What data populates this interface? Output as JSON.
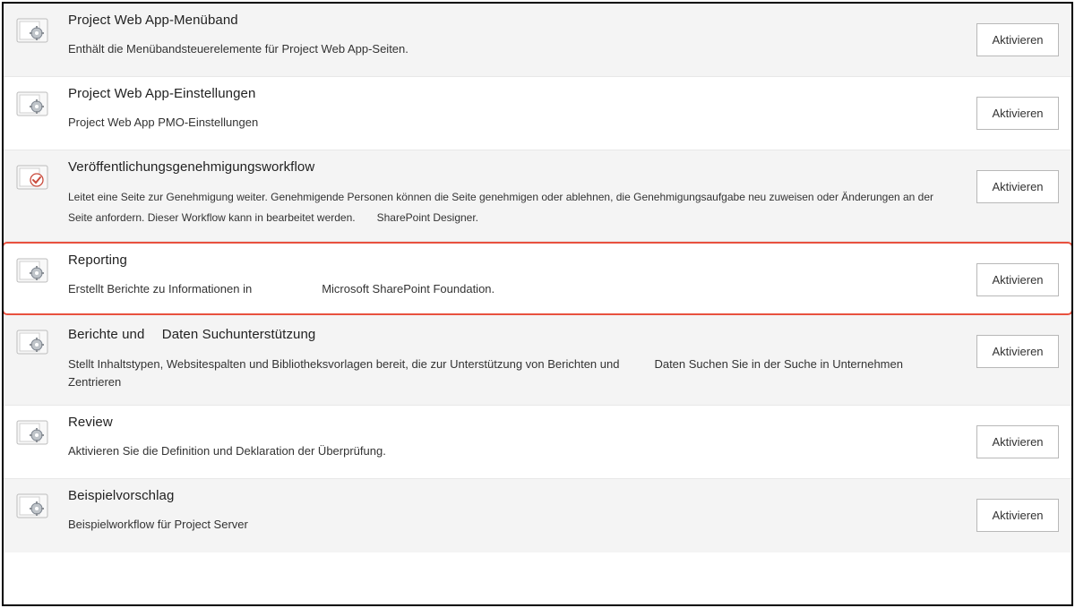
{
  "activateLabel": "Aktivieren",
  "features": [
    {
      "icon": "gear",
      "title": "Project Web App-Menüband",
      "desc": "Enthält die Menübandsteuerelemente für Project Web App-Seiten."
    },
    {
      "icon": "gear",
      "title": "Project Web App-Einstellungen",
      "desc": "Project Web App PMO-Einstellungen"
    },
    {
      "icon": "check",
      "title": "Veröffentlichungsgenehmigungsworkflow",
      "desc": "Leitet eine Seite zur Genehmigung weiter. Genehmigende Personen können die Seite genehmigen oder ablehnen, die Genehmigungsaufgabe neu zuweisen oder Änderungen an der Seite anfordern. Dieser Workflow kann in bearbeitet werden.　　SharePoint Designer."
    },
    {
      "icon": "gear",
      "title": "Reporting",
      "desc": "Erstellt Berichte zu Informationen in　　　　　　Microsoft SharePoint Foundation."
    },
    {
      "icon": "gear",
      "title": "Berichte und　 Daten  Suchunterstützung",
      "desc": "Stellt Inhaltstypen, Websitespalten und Bibliotheksvorlagen bereit, die zur Unterstützung von Berichten und　　　Daten  Suchen Sie in der Suche in Unternehmen  Zentrieren"
    },
    {
      "icon": "gear",
      "title": "Review",
      "desc": "Aktivieren Sie die Definition und Deklaration der Überprüfung."
    },
    {
      "icon": "gear",
      "title": "Beispielvorschlag",
      "desc": "Beispielworkflow für Project Server"
    }
  ]
}
